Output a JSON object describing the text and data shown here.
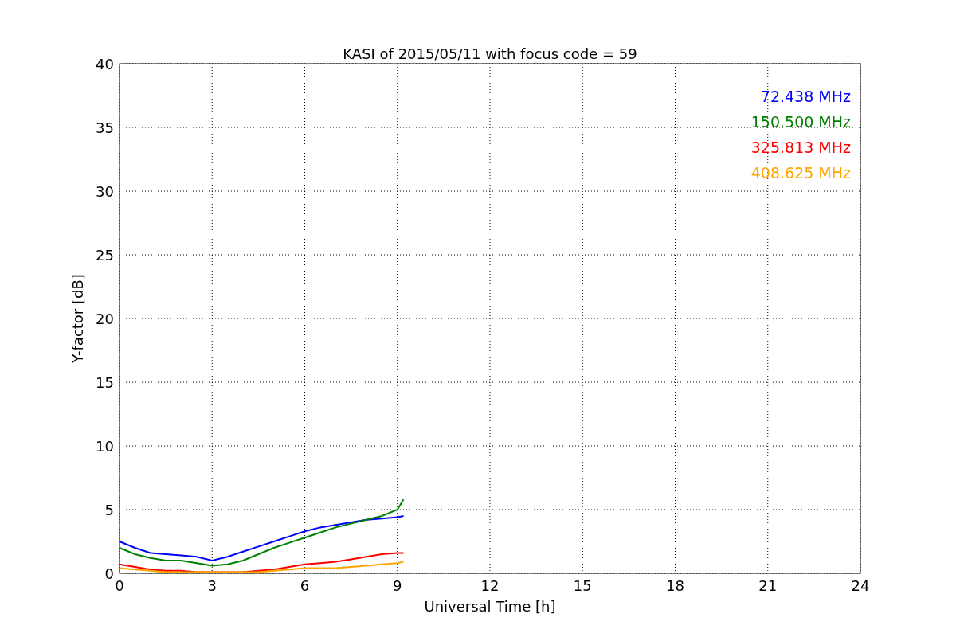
{
  "chart_data": {
    "type": "line",
    "title": "KASI of 2015/05/11 with focus code = 59",
    "xlabel": "Universal Time [h]",
    "ylabel": "Y-factor [dB]",
    "x": [
      0,
      0.5,
      1,
      1.5,
      2,
      2.5,
      3,
      3.5,
      4,
      4.5,
      5,
      5.5,
      6,
      6.5,
      7,
      7.5,
      8,
      8.5,
      9,
      9.2
    ],
    "series": [
      {
        "name": "72.438 MHz",
        "color": "#0000ff",
        "values": [
          2.5,
          2.0,
          1.6,
          1.5,
          1.4,
          1.3,
          1.0,
          1.3,
          1.7,
          2.1,
          2.5,
          2.9,
          3.3,
          3.6,
          3.8,
          4.0,
          4.2,
          4.3,
          4.4,
          4.5
        ]
      },
      {
        "name": "150.500 MHz",
        "color": "#008000",
        "values": [
          2.0,
          1.5,
          1.2,
          1.0,
          1.0,
          0.8,
          0.6,
          0.7,
          1.0,
          1.5,
          2.0,
          2.4,
          2.8,
          3.2,
          3.6,
          3.9,
          4.2,
          4.5,
          5.0,
          5.8
        ]
      },
      {
        "name": "325.813 MHz",
        "color": "#ff0000",
        "values": [
          0.7,
          0.5,
          0.3,
          0.2,
          0.2,
          0.1,
          0.1,
          0.1,
          0.1,
          0.2,
          0.3,
          0.5,
          0.7,
          0.8,
          0.9,
          1.1,
          1.3,
          1.5,
          1.6,
          1.6
        ]
      },
      {
        "name": "408.625 MHz",
        "color": "#ffa500",
        "values": [
          0.4,
          0.3,
          0.2,
          0.1,
          0.1,
          0.1,
          0.1,
          0.1,
          0.1,
          0.1,
          0.2,
          0.3,
          0.4,
          0.4,
          0.4,
          0.5,
          0.6,
          0.7,
          0.8,
          0.9
        ]
      }
    ],
    "xlim": [
      0,
      24
    ],
    "ylim": [
      0,
      40
    ],
    "xticks": [
      0,
      3,
      6,
      9,
      12,
      15,
      18,
      21,
      24
    ],
    "yticks": [
      0,
      5,
      10,
      15,
      20,
      25,
      30,
      35,
      40
    ],
    "grid": true
  }
}
